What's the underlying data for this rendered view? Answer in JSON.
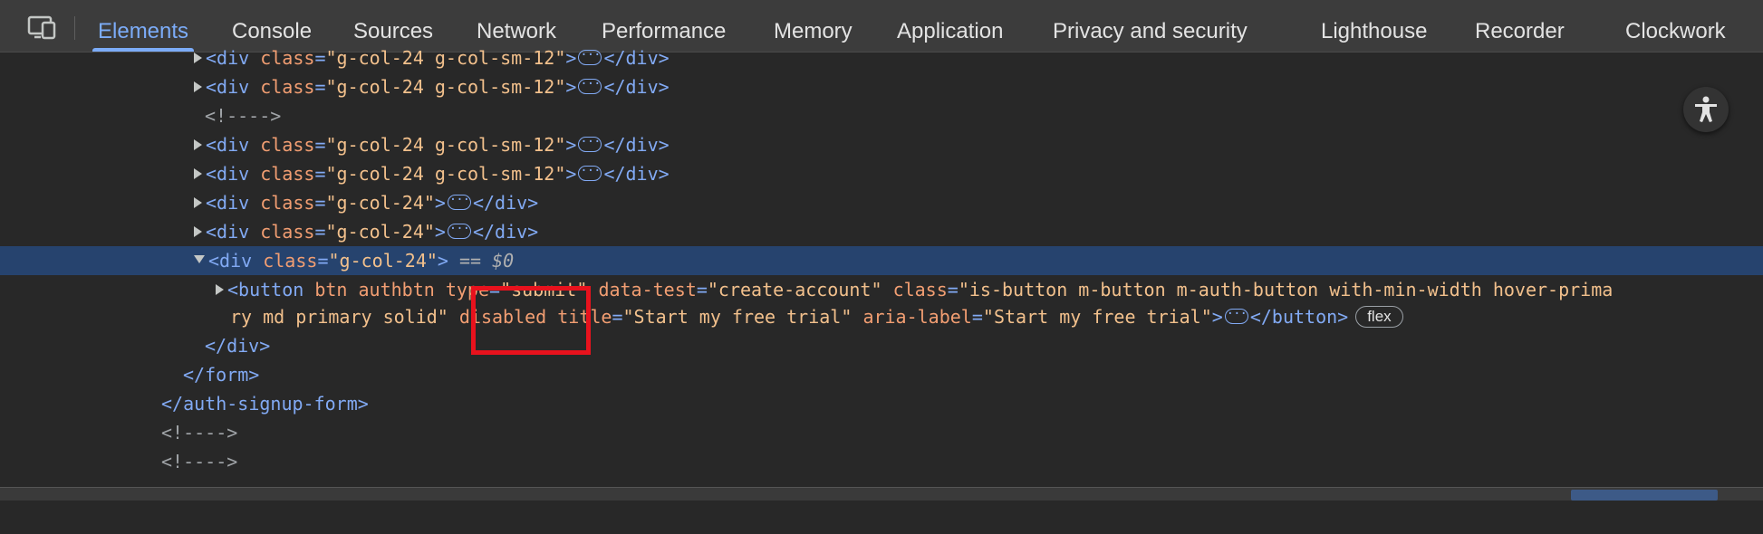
{
  "tabs": [
    {
      "label": "Elements",
      "active": true
    },
    {
      "label": "Console"
    },
    {
      "label": "Sources"
    },
    {
      "label": "Network"
    },
    {
      "label": "Performance"
    },
    {
      "label": "Memory"
    },
    {
      "label": "Application"
    },
    {
      "label": "Privacy and security"
    },
    {
      "label": "Lighthouse"
    },
    {
      "label": "Recorder"
    },
    {
      "label": "Clockwork"
    }
  ],
  "icons": {
    "device_toggle": "device-toolbar-icon",
    "inspect": "inspect-icon",
    "accessibility": "accessibility-icon"
  },
  "colors": {
    "tag": "#82aaf4",
    "attribute": "#f29e72",
    "value": "#f2c08c",
    "selected_row": "#26436e",
    "highlight_box": "#e8121d"
  },
  "tree": {
    "l1": {
      "tag": "<div",
      "attr": "class",
      "val": "\"g-col-24 g-col-sm-12\"",
      "close": "</div>"
    },
    "l2": {
      "tag": "<div",
      "attr": "class",
      "val": "\"g-col-24 g-col-sm-12\"",
      "close": "</div>"
    },
    "l3": {
      "text": "<!---->"
    },
    "l4": {
      "tag": "<div",
      "attr": "class",
      "val": "\"g-col-24 g-col-sm-12\"",
      "close": "</div>"
    },
    "l5": {
      "tag": "<div",
      "attr": "class",
      "val": "\"g-col-24 g-col-sm-12\"",
      "close": "</div>"
    },
    "l6": {
      "tag": "<div",
      "attr": "class",
      "val": "\"g-col-24\"",
      "close": "</div>"
    },
    "l7": {
      "tag": "<div",
      "attr": "class",
      "val": "\"g-col-24\"",
      "close": "</div>"
    },
    "l8": {
      "tag": "<div",
      "attr": "class",
      "val": "\"g-col-24\"",
      "eq": "== $0"
    },
    "l9": {
      "tag": "<button",
      "attrs_plain": "btn authbtn",
      "type_attr": "type",
      "type_val": "\"submit\"",
      "test_attr": "data-test",
      "test_val": "\"create-account\"",
      "class_attr": "class",
      "class_val_1": "\"is-button m-button m-auth-button with-min-width hover-prima"
    },
    "l10": {
      "class_val_2": "ry md primary solid\"",
      "disabled": "disabled",
      "title_attr": "title",
      "title_val": "\"Start my free trial\"",
      "aria_attr": "aria-label",
      "aria_val": "\"Start my free trial\"",
      "close": "</button>",
      "badge": "flex"
    },
    "l11": {
      "text": "</div>"
    },
    "l12": {
      "text": "</form>"
    },
    "l13": {
      "text": "</auth-signup-form>"
    },
    "l14": {
      "text": "<!---->"
    },
    "l15": {
      "text": "<!---->"
    }
  }
}
